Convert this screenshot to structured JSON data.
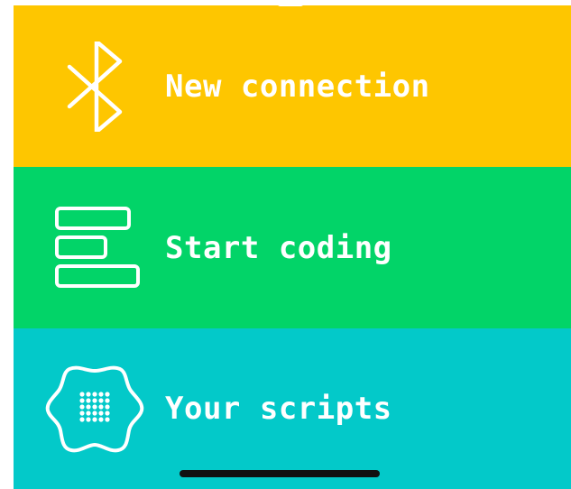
{
  "menu": {
    "items": [
      {
        "id": "new-connection",
        "label": "New connection",
        "icon": "bluetooth-icon",
        "color": "#FEC600"
      },
      {
        "id": "start-coding",
        "label": "Start coding",
        "icon": "code-blocks-icon",
        "color": "#02D468"
      },
      {
        "id": "your-scripts",
        "label": "Your scripts",
        "icon": "scripts-badge-icon",
        "color": "#03C9C9"
      }
    ]
  },
  "colors": {
    "text": "#FFFFFF",
    "home_indicator": "#111111"
  }
}
